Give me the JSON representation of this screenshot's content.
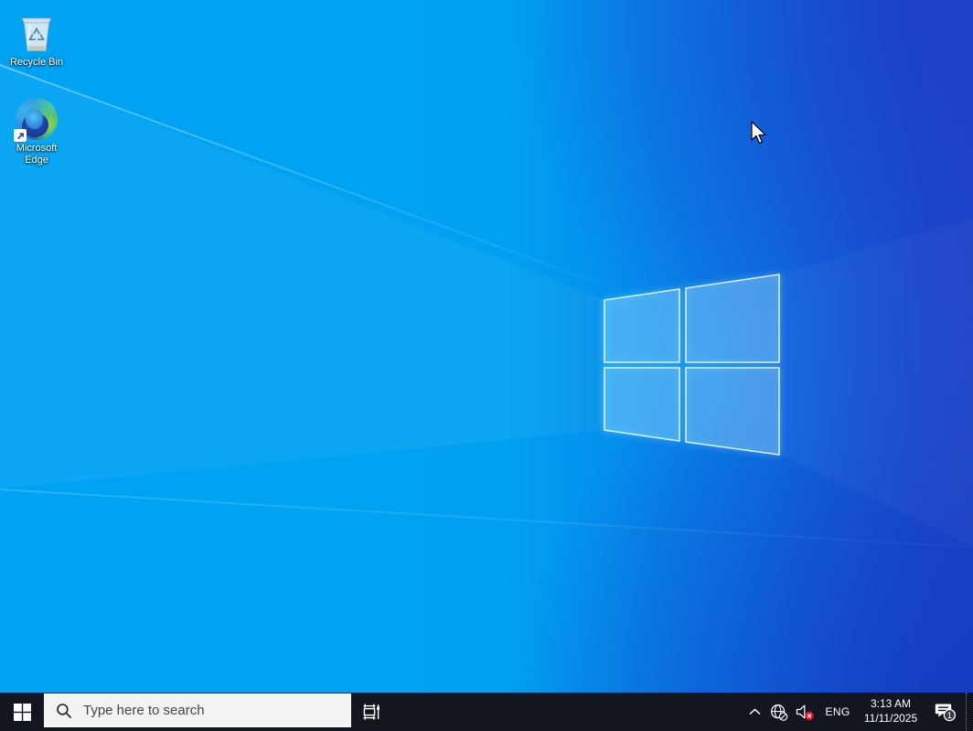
{
  "desktop": {
    "icons": [
      {
        "label": "Recycle Bin"
      },
      {
        "label": "Microsoft Edge"
      }
    ]
  },
  "taskbar": {
    "search": {
      "placeholder": "Type here to search"
    },
    "tray": {
      "language": "ENG",
      "time": "3:13 AM",
      "date": "11/11/2025",
      "notification_count": "1"
    }
  },
  "colors": {
    "wallpaper_azure": "#00a1f1",
    "wallpaper_royal": "#1b46c8",
    "taskbar_background": "#11161f",
    "search_box_background": "#f3f3f3",
    "volume_muted_badge": "#e81123"
  }
}
